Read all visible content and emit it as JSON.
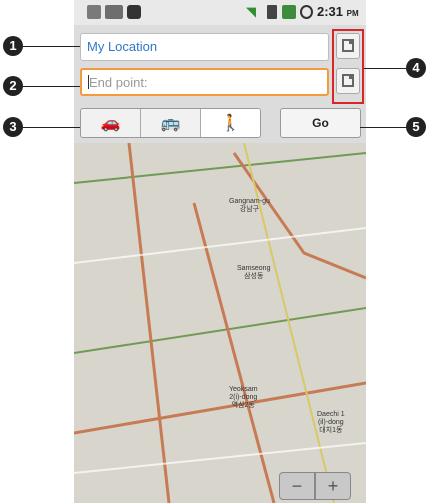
{
  "status_bar": {
    "time": "2:31",
    "ampm": "PM"
  },
  "route": {
    "start_value": "My Location",
    "end_placeholder": "End point:"
  },
  "modes": [
    {
      "name": "car",
      "icon": "car-icon",
      "glyph": "🚗",
      "selected": false
    },
    {
      "name": "bus",
      "icon": "bus-icon",
      "glyph": "🚌",
      "selected": false
    },
    {
      "name": "walk",
      "icon": "walking-icon",
      "glyph": "🚶",
      "selected": true
    }
  ],
  "go_label": "Go",
  "callouts": [
    "1",
    "2",
    "3",
    "4",
    "5"
  ],
  "map": {
    "labels": [
      "Gangnam-gu\n강남구",
      "Samseong\n삼성동",
      "Yeoksam\n2(i)-dong\n역삼2동",
      "Daechi 1\n(il)-dong\n대치1동"
    ],
    "zoom_out": "−",
    "zoom_in": "+"
  },
  "colors": {
    "start_text": "#2f78c8",
    "end_border": "#f39a3c",
    "highlight": "#d9242a"
  }
}
